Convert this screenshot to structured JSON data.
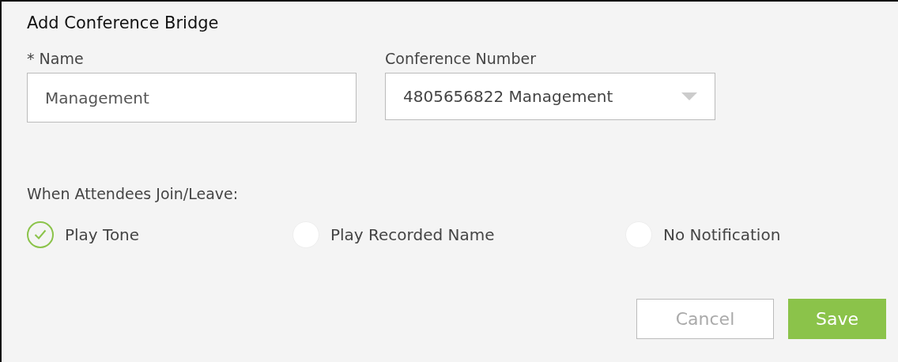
{
  "dialog": {
    "title": "Add Conference Bridge"
  },
  "fields": [
    {
      "kind": "text",
      "label": "* Name",
      "value": "Management"
    },
    {
      "kind": "select",
      "label": "Conference Number",
      "value": "4805656822 Management"
    }
  ],
  "notification": {
    "label": "When Attendees Join/Leave:",
    "options": [
      {
        "label": "Play Tone",
        "selected": true
      },
      {
        "label": "Play Recorded Name",
        "selected": false
      },
      {
        "label": "No Notification",
        "selected": false
      }
    ]
  },
  "buttons": [
    {
      "kind": "secondary",
      "label": "Cancel"
    },
    {
      "kind": "primary",
      "label": "Save"
    }
  ]
}
